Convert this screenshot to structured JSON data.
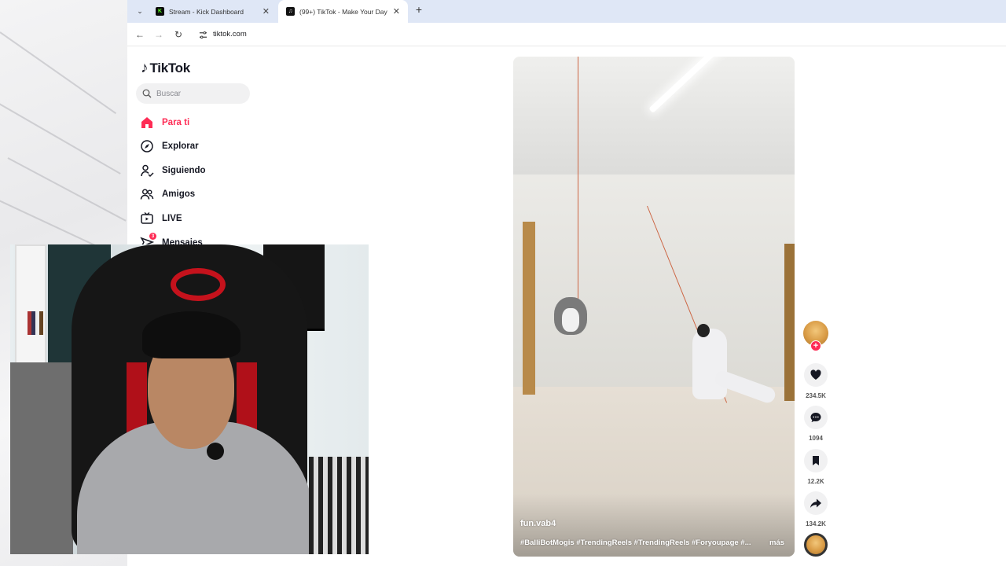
{
  "browser": {
    "tabs": [
      {
        "title": "Stream - Kick Dashboard",
        "favicon": "kick-icon",
        "active": false
      },
      {
        "title": "(99+) TikTok - Make Your Day",
        "favicon": "tiktok-icon",
        "active": true
      }
    ],
    "url": "tiktok.com"
  },
  "tiktok": {
    "logo_text": "TikTok",
    "search_placeholder": "Buscar",
    "menu": [
      {
        "label": "Para ti",
        "icon": "home-icon",
        "active": true
      },
      {
        "label": "Explorar",
        "icon": "compass-icon"
      },
      {
        "label": "Siguiendo",
        "icon": "following-icon"
      },
      {
        "label": "Amigos",
        "icon": "friends-icon"
      },
      {
        "label": "LIVE",
        "icon": "live-icon"
      },
      {
        "label": "Mensajes",
        "icon": "messages-icon",
        "badge": "3"
      }
    ],
    "accent_color": "#fe2c55"
  },
  "video": {
    "author": "fun.vab4",
    "caption": "#BalliBotMogis #TrendingReels #TrendingReels #Foryoupage #...",
    "more_label": "más",
    "likes": "234.5K",
    "comments": "1094",
    "saves": "12.2K",
    "shares": "134.2K"
  }
}
